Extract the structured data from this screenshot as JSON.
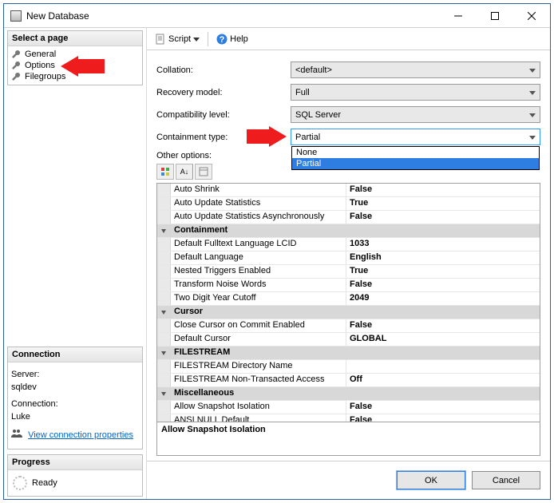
{
  "window": {
    "title": "New Database"
  },
  "sidebar": {
    "select_page_header": "Select a page",
    "items": [
      {
        "label": "General"
      },
      {
        "label": "Options"
      },
      {
        "label": "Filegroups"
      }
    ],
    "connection": {
      "header": "Connection",
      "server_label": "Server:",
      "server_value": "sqldev",
      "connection_label": "Connection:",
      "connection_value": "Luke",
      "link": "View connection properties"
    },
    "progress": {
      "header": "Progress",
      "status": "Ready"
    }
  },
  "toolbar": {
    "script_label": "Script",
    "help_label": "Help"
  },
  "form": {
    "collation_label": "Collation:",
    "collation_value": "<default>",
    "recovery_label": "Recovery model:",
    "recovery_value": "Full",
    "compat_label": "Compatibility level:",
    "compat_value": "SQL Server",
    "containment_label": "Containment type:",
    "containment_value": "Partial",
    "containment_options": [
      "None",
      "Partial"
    ],
    "other_options_label": "Other options:"
  },
  "propgrid": {
    "rows": [
      {
        "name": "Auto Shrink",
        "value": "False"
      },
      {
        "name": "Auto Update Statistics",
        "value": "True"
      },
      {
        "name": "Auto Update Statistics Asynchronously",
        "value": "False"
      },
      {
        "cat": true,
        "name": "Containment"
      },
      {
        "name": "Default Fulltext Language LCID",
        "value": "1033"
      },
      {
        "name": "Default Language",
        "value": "English"
      },
      {
        "name": "Nested Triggers Enabled",
        "value": "True"
      },
      {
        "name": "Transform Noise Words",
        "value": "False"
      },
      {
        "name": "Two Digit Year Cutoff",
        "value": "2049"
      },
      {
        "cat": true,
        "name": "Cursor"
      },
      {
        "name": "Close Cursor on Commit Enabled",
        "value": "False"
      },
      {
        "name": "Default Cursor",
        "value": "GLOBAL"
      },
      {
        "cat": true,
        "name": "FILESTREAM"
      },
      {
        "name": "FILESTREAM Directory Name",
        "value": ""
      },
      {
        "name": "FILESTREAM Non-Transacted Access",
        "value": "Off"
      },
      {
        "cat": true,
        "name": "Miscellaneous"
      },
      {
        "name": "Allow Snapshot Isolation",
        "value": "False"
      },
      {
        "name": "ANSI NULL Default",
        "value": "False"
      }
    ],
    "desc_name": "Allow Snapshot Isolation",
    "desc_text": ""
  },
  "buttons": {
    "ok": "OK",
    "cancel": "Cancel"
  }
}
